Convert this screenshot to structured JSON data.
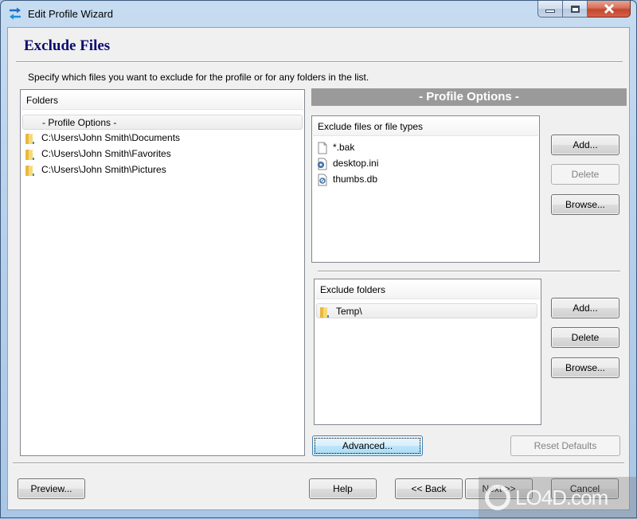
{
  "window": {
    "title": "Edit Profile Wizard",
    "icon": "sync-arrows-icon",
    "caption_buttons": [
      "minimize",
      "maximize",
      "close"
    ]
  },
  "page": {
    "title": "Exclude Files",
    "instruction": "Specify which files you want to exclude for the profile or for any folders in the list."
  },
  "folders_panel": {
    "header": "Folders",
    "items": [
      {
        "label": "- Profile Options -",
        "icon": "",
        "selected": true
      },
      {
        "label": "C:\\Users\\John Smith\\Documents",
        "icon": "folder-icon",
        "selected": false
      },
      {
        "label": "C:\\Users\\John Smith\\Favorites",
        "icon": "folder-icon",
        "selected": false
      },
      {
        "label": "C:\\Users\\John Smith\\Pictures",
        "icon": "folder-icon",
        "selected": false
      }
    ]
  },
  "options_banner": "- Profile Options -",
  "exclude_files": {
    "header": "Exclude files or file types",
    "items": [
      {
        "label": "*.bak",
        "icon": "blank-file-icon"
      },
      {
        "label": "desktop.ini",
        "icon": "settings-file-icon"
      },
      {
        "label": "thumbs.db",
        "icon": "database-file-icon"
      }
    ],
    "buttons": {
      "add": "Add...",
      "delete": "Delete",
      "browse": "Browse..."
    },
    "delete_enabled": false
  },
  "exclude_folders": {
    "header": "Exclude folders",
    "items": [
      {
        "label": "Temp\\",
        "icon": "folder-icon",
        "selected": true
      }
    ],
    "buttons": {
      "add": "Add...",
      "delete": "Delete",
      "browse": "Browse..."
    },
    "delete_enabled": true
  },
  "advanced_button": "Advanced...",
  "reset_defaults_button": "Reset Defaults",
  "footer": {
    "preview": "Preview...",
    "help": "Help",
    "back": "<< Back",
    "next": "Next >>",
    "cancel": "Cancel"
  },
  "watermark": "LO4D.com"
}
